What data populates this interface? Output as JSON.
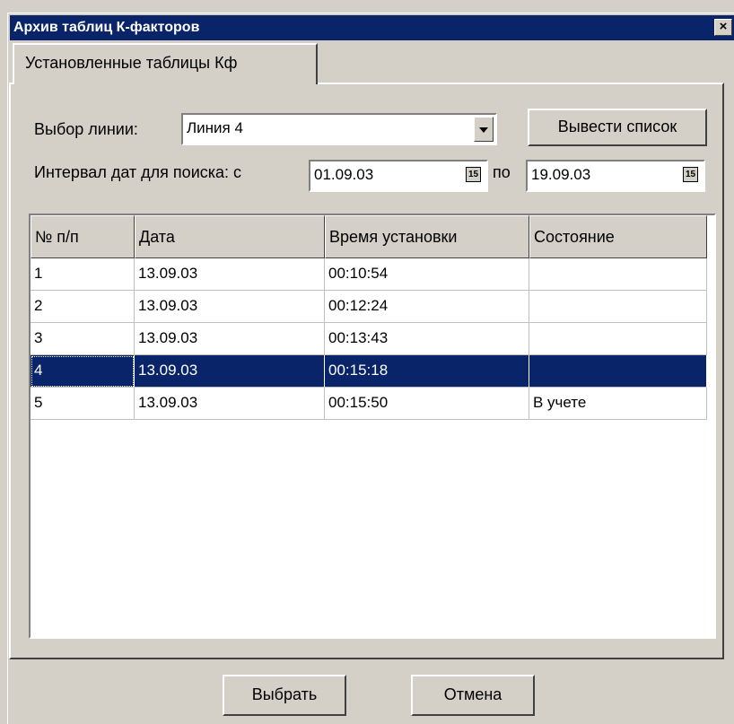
{
  "window": {
    "title": "Архив таблиц К-факторов",
    "close_label": "×"
  },
  "tab": {
    "label": "Установленные таблицы Кф"
  },
  "line_select": {
    "label": "Выбор линии:",
    "value": "Линия 4"
  },
  "list_button": {
    "label": "Вывести список"
  },
  "date_range": {
    "label": "Интервал дат для поиска: с",
    "from": "01.09.03",
    "to_label": "по",
    "to": "19.09.03",
    "calendar_glyph": "15"
  },
  "table": {
    "headers": [
      "№ п/п",
      "Дата",
      "Время установки",
      "Состояние"
    ],
    "rows": [
      {
        "n": "1",
        "date": "13.09.03",
        "time": "00:10:54",
        "state": ""
      },
      {
        "n": "2",
        "date": "13.09.03",
        "time": "00:12:24",
        "state": ""
      },
      {
        "n": "3",
        "date": "13.09.03",
        "time": "00:13:43",
        "state": ""
      },
      {
        "n": "4",
        "date": "13.09.03",
        "time": "00:15:18",
        "state": ""
      },
      {
        "n": "5",
        "date": "13.09.03",
        "time": "00:15:50",
        "state": "В учете"
      }
    ],
    "selected_row": 4
  },
  "footer": {
    "select_label": "Выбрать",
    "cancel_label": "Отмена"
  },
  "colors": {
    "titlebar": "#0a246a",
    "face": "#d4d0c8",
    "selection": "#0a246a"
  }
}
